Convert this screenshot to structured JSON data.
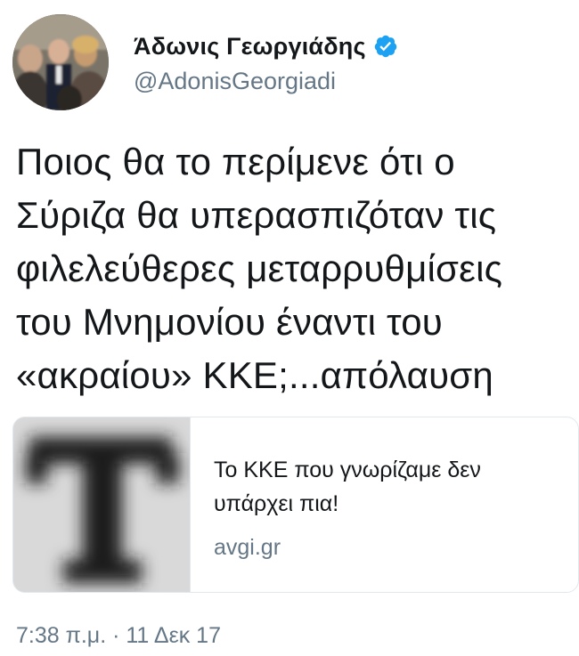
{
  "author": {
    "display_name": "Άδωνις Γεωργιάδης",
    "handle": "@AdonisGeorgiadi",
    "verified": true,
    "avatar": "profile-photo"
  },
  "tweet": {
    "text": "Ποιος θα το περίμενε ότι ο\nΣύριζα θα υπερασπιζόταν τις\nφιλελεύθερες μεταρρυθμίσεις\nτου Μνημονίου έναντι του\n«ακραίου» ΚΚΕ;...απόλαυση",
    "timestamp": "7:38 π.μ. · 11 Δεκ 17"
  },
  "card": {
    "title": "Το ΚΚΕ που γνωρίζαμε δεν υπάρχει πια!",
    "domain": "avgi.gr",
    "thumbnail": "blurred-T-logo"
  },
  "colors": {
    "text": "#14171a",
    "secondary": "#657786",
    "verified_badge": "#1da1f2",
    "card_border": "#e1e8ed"
  }
}
